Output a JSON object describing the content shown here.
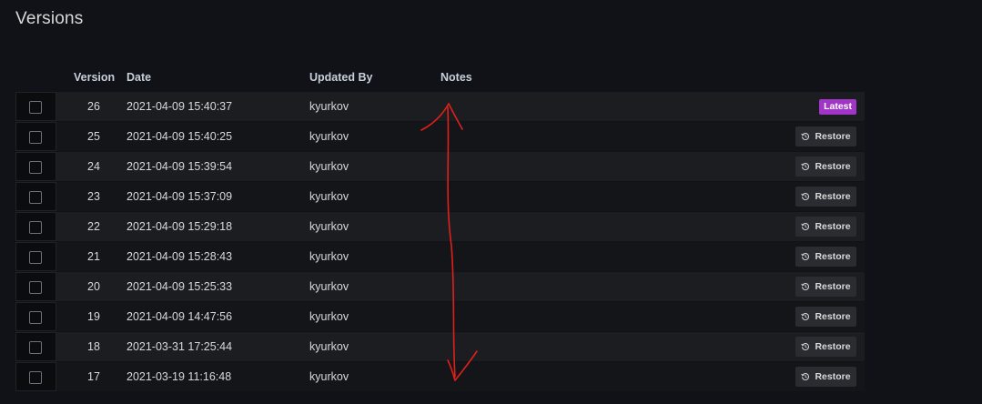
{
  "page": {
    "title": "Versions"
  },
  "table": {
    "headers": {
      "version": "Version",
      "date": "Date",
      "updated_by": "Updated By",
      "notes": "Notes"
    },
    "rows": [
      {
        "version": "26",
        "date": "2021-04-09 15:40:37",
        "updated_by": "kyurkov",
        "notes": "",
        "action": "Latest"
      },
      {
        "version": "25",
        "date": "2021-04-09 15:40:25",
        "updated_by": "kyurkov",
        "notes": "",
        "action": "Restore"
      },
      {
        "version": "24",
        "date": "2021-04-09 15:39:54",
        "updated_by": "kyurkov",
        "notes": "",
        "action": "Restore"
      },
      {
        "version": "23",
        "date": "2021-04-09 15:37:09",
        "updated_by": "kyurkov",
        "notes": "",
        "action": "Restore"
      },
      {
        "version": "22",
        "date": "2021-04-09 15:29:18",
        "updated_by": "kyurkov",
        "notes": "",
        "action": "Restore"
      },
      {
        "version": "21",
        "date": "2021-04-09 15:28:43",
        "updated_by": "kyurkov",
        "notes": "",
        "action": "Restore"
      },
      {
        "version": "20",
        "date": "2021-04-09 15:25:33",
        "updated_by": "kyurkov",
        "notes": "",
        "action": "Restore"
      },
      {
        "version": "19",
        "date": "2021-04-09 14:47:56",
        "updated_by": "kyurkov",
        "notes": "",
        "action": "Restore"
      },
      {
        "version": "18",
        "date": "2021-03-31 17:25:44",
        "updated_by": "kyurkov",
        "notes": "",
        "action": "Restore"
      },
      {
        "version": "17",
        "date": "2021-03-19 11:16:48",
        "updated_by": "kyurkov",
        "notes": "",
        "action": "Restore"
      }
    ]
  },
  "colors": {
    "background": "#111217",
    "latest_badge": "#a035c6",
    "restore_button": "#2a2c31",
    "annotation_arrow": "#e0201a"
  },
  "icons": {
    "restore": "history-icon"
  }
}
